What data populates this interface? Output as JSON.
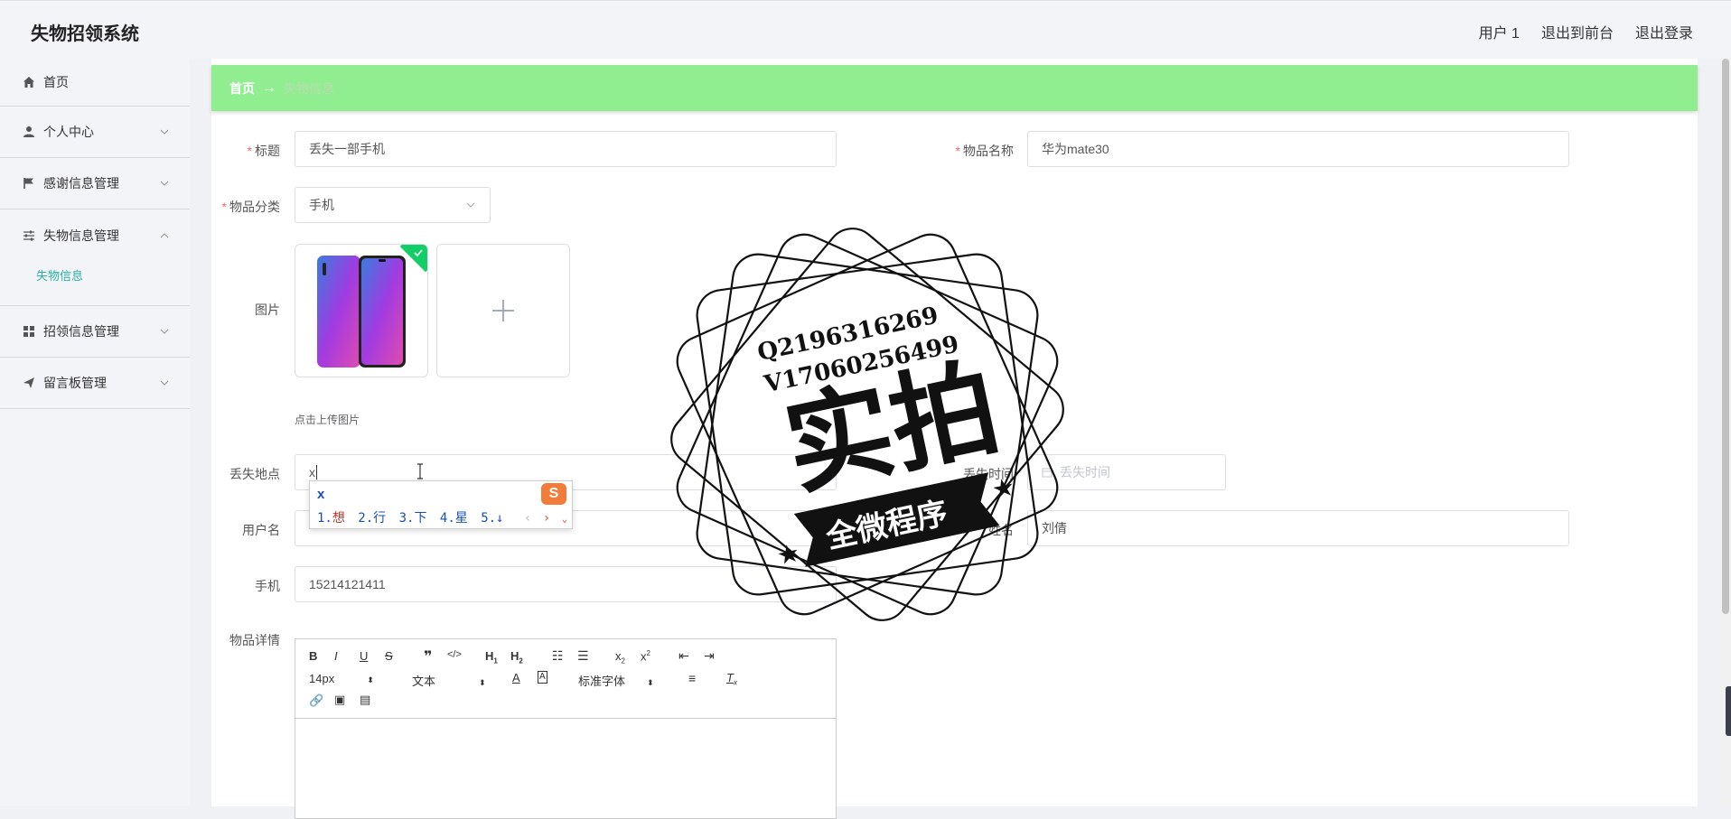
{
  "header": {
    "app_title": "失物招领系统",
    "user_label": "用户 1",
    "exit_front_label": "退出到前台",
    "logout_label": "退出登录"
  },
  "sidebar": {
    "items": [
      {
        "label": "首页",
        "icon": "home-icon"
      },
      {
        "label": "个人中心",
        "icon": "user-icon"
      },
      {
        "label": "感谢信息管理",
        "icon": "flag-icon"
      },
      {
        "label": "失物信息管理",
        "icon": "sliders-icon",
        "expanded": true
      },
      {
        "label": "招领信息管理",
        "icon": "grid-icon"
      },
      {
        "label": "留言板管理",
        "icon": "send-icon"
      }
    ],
    "sub_item": "失物信息"
  },
  "breadcrumb": {
    "home": "首页",
    "arrow": "→",
    "current": "失物信息"
  },
  "form": {
    "title_label": "标题",
    "title_value": "丢失一部手机",
    "name_label": "物品名称",
    "name_value": "华为mate30",
    "category_label": "物品分类",
    "category_value": "手机",
    "image_label": "图片",
    "upload_hint": "点击上传图片",
    "location_label": "丢失地点",
    "location_value": "x",
    "time_label": "丢失时间",
    "time_placeholder": "丢失时间",
    "username_label": "用户名",
    "fullname_label": "姓名",
    "fullname_value": "刘倩",
    "phone_label": "手机",
    "phone_value": "15214121411",
    "detail_label": "物品详情"
  },
  "editor": {
    "font_size": "14px",
    "text_style": "文本",
    "font_family": "标准字体"
  },
  "ime": {
    "composition": "x",
    "candidates": [
      {
        "n": "1.",
        "w": "想"
      },
      {
        "n": "2.",
        "w": "行"
      },
      {
        "n": "3.",
        "w": "下"
      },
      {
        "n": "4.",
        "w": "星"
      },
      {
        "n": "5.",
        "w": "↓"
      }
    ]
  },
  "watermark": {
    "line1": "Q2196316269",
    "line2": "V17060256499",
    "main": "实拍",
    "banner": "全微程序"
  },
  "colors": {
    "breadcrumb_bg": "#90ee90",
    "active_sub": "#2bb3a3",
    "required": "#f56c6c"
  }
}
